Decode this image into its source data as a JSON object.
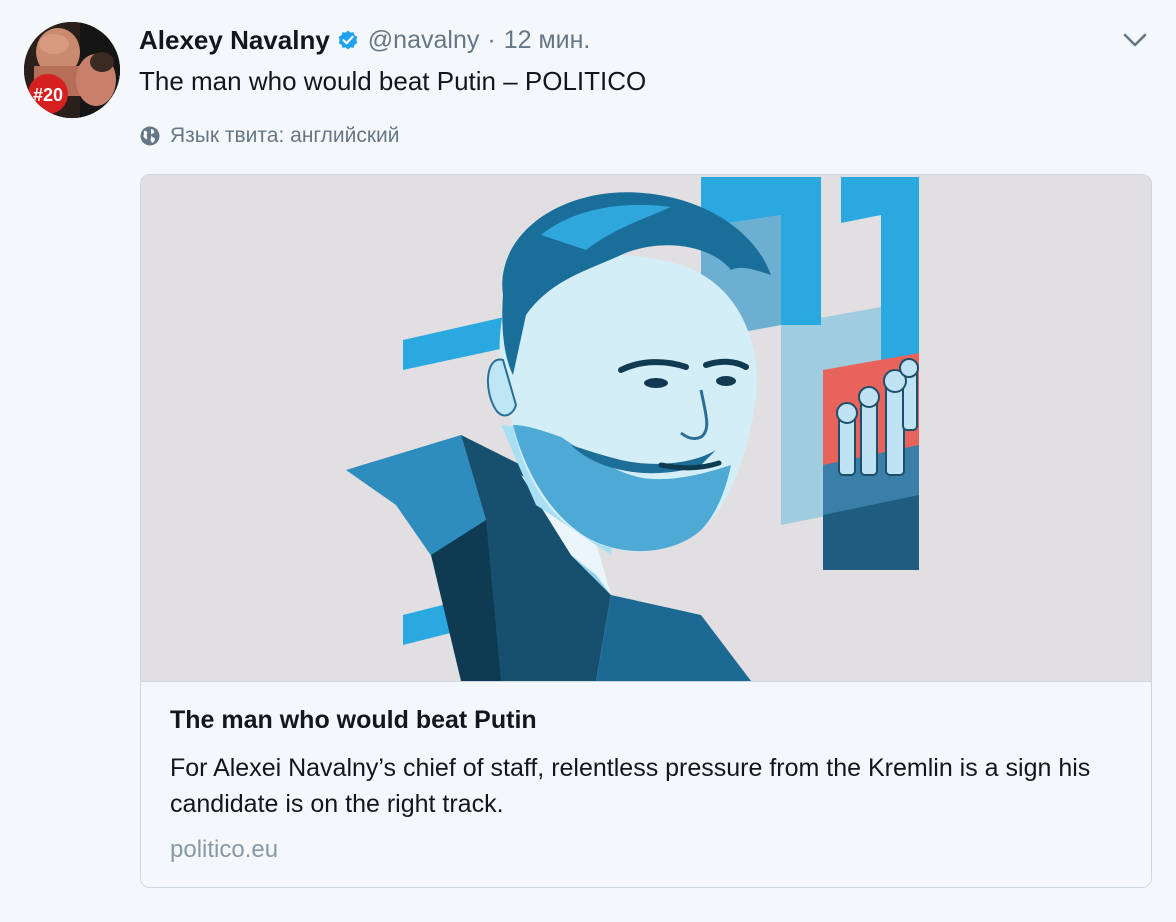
{
  "tweet": {
    "author_name": "Alexey Navalny",
    "author_handle": "@navalny",
    "separator": "·",
    "time": "12 мин.",
    "text": "The man who would beat Putin – POLITICO",
    "language_note": "Язык твита: английский",
    "avatar_badge": "#20",
    "verified": true
  },
  "card": {
    "title": "The man who would beat Putin",
    "description": "For Alexei Navalny’s chief of staff, relentless pressure from the Kremlin is a sign his candidate is on the right track.",
    "domain": "politico.eu"
  },
  "icons": {
    "verified": "verified-badge-icon",
    "caret": "chevron-down-icon",
    "globe": "globe-icon"
  },
  "colors": {
    "background": "#f5f8fa",
    "text_primary": "#14171a",
    "text_secondary": "#657786",
    "verified_blue": "#1da1f2",
    "card_border": "#ccd6dd",
    "illustration_blue": "#29a9e0",
    "illustration_red": "#e8635b",
    "illustration_bg": "#e1dfe1"
  }
}
